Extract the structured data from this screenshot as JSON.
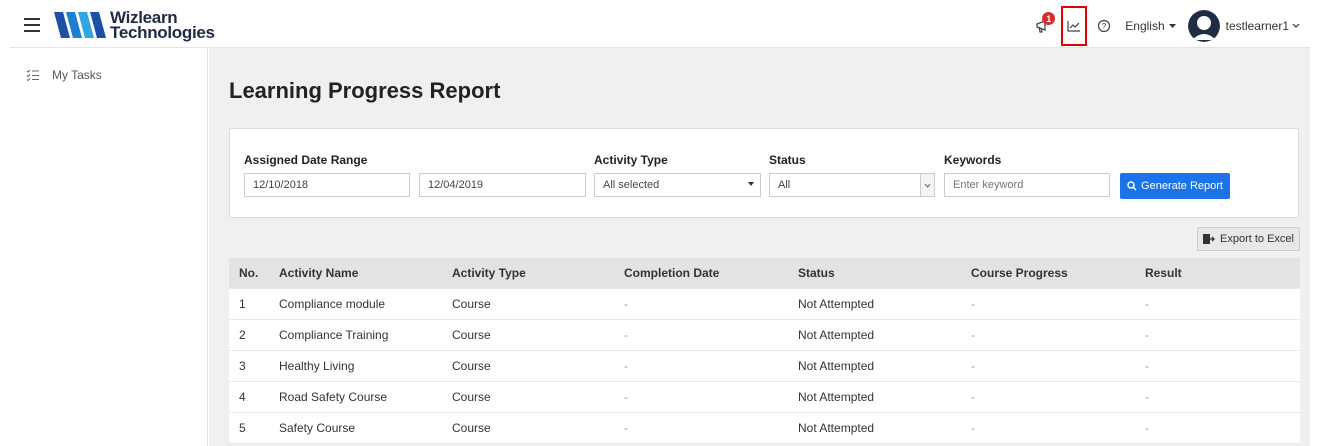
{
  "header": {
    "logo_line1": "Wizlearn",
    "logo_line2": "Technologies",
    "notification_count": "1",
    "language": "English",
    "username": "testlearner1"
  },
  "sidebar": {
    "items": [
      {
        "label": "My Tasks",
        "icon": "task-list-icon"
      }
    ]
  },
  "page": {
    "title": "Learning Progress Report"
  },
  "filters": {
    "date_range_label": "Assigned Date Range",
    "date_from": "12/10/2018",
    "date_to": "12/04/2019",
    "activity_type_label": "Activity Type",
    "activity_type_value": "All selected",
    "status_label": "Status",
    "status_value": "All",
    "keywords_label": "Keywords",
    "keywords_placeholder": "Enter keyword",
    "generate_label": "Generate Report"
  },
  "export_label": "Export to Excel",
  "table": {
    "headers": [
      "No.",
      "Activity Name",
      "Activity Type",
      "Completion Date",
      "Status",
      "Course Progress",
      "Result"
    ],
    "rows": [
      [
        "1",
        "Compliance module",
        "Course",
        "-",
        "Not Attempted",
        "-",
        "-"
      ],
      [
        "2",
        "Compliance Training",
        "Course",
        "-",
        "Not Attempted",
        "-",
        "-"
      ],
      [
        "3",
        "Healthy Living",
        "Course",
        "-",
        "Not Attempted",
        "-",
        "-"
      ],
      [
        "4",
        "Road Safety Course",
        "Course",
        "-",
        "Not Attempted",
        "-",
        "-"
      ],
      [
        "5",
        "Safety Course",
        "Course",
        "-",
        "Not Attempted",
        "-",
        "-"
      ]
    ]
  },
  "colors": {
    "primary_button": "#1a73e8",
    "badge": "#d32f2f",
    "highlight_box": "#e00000",
    "logo_blue": "#1e7fd1"
  }
}
